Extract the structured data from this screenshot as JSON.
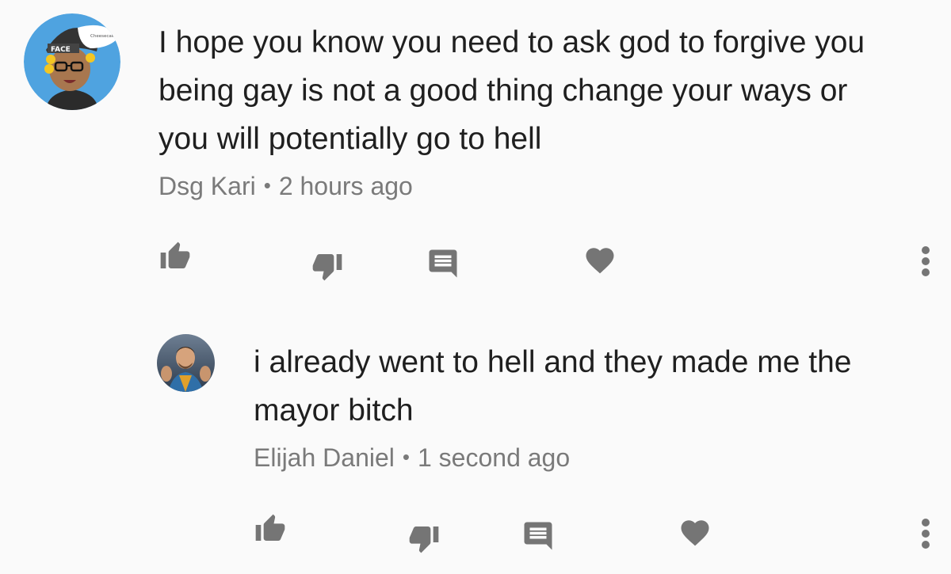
{
  "comments": [
    {
      "avatar": {
        "icon": "cartoon-avatar-icon",
        "badge_text": "Cheesecake",
        "hat_text": "FACE"
      },
      "lines": [
        "I hope you know you need to ask god to forgive you",
        "being gay is not a good thing change your ways or",
        "you will potentially go to hell"
      ],
      "author": "Dsg Kari",
      "separator": "•",
      "time": "2 hours ago",
      "actions": {
        "like": "thumbs-up-icon",
        "dislike": "thumbs-down-icon",
        "reply": "comment-icon",
        "heart": "heart-icon",
        "more": "more-vertical-icon"
      }
    },
    {
      "avatar": {
        "icon": "photo-avatar-icon"
      },
      "lines": [
        "i already went to hell and they made me the",
        "mayor bitch"
      ],
      "author": "Elijah Daniel",
      "separator": "•",
      "time": "1 second ago",
      "actions": {
        "like": "thumbs-up-icon",
        "dislike": "thumbs-down-icon",
        "reply": "comment-icon",
        "heart": "heart-icon",
        "more": "more-vertical-icon"
      }
    }
  ],
  "colors": {
    "background": "#fafafa",
    "text": "#1f1f1f",
    "meta": "#7a7a7a",
    "icon": "#757575",
    "avatar_bg": "#4fa3e0"
  }
}
